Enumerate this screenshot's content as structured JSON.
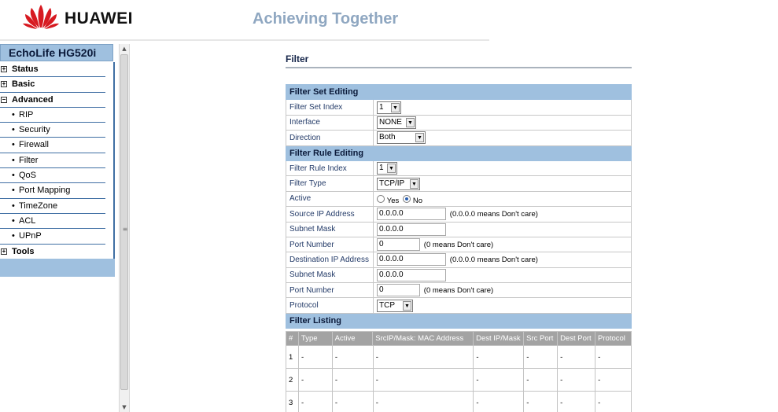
{
  "header": {
    "brand": "HUAWEI",
    "slogan": "Achieving Together",
    "logo_icon": "huawei-petal-logo"
  },
  "sidebar": {
    "model": "EchoLife HG520i",
    "items": [
      {
        "label": "Status",
        "kind": "top",
        "toggle": "+"
      },
      {
        "label": "Basic",
        "kind": "top",
        "toggle": "+"
      },
      {
        "label": "Advanced",
        "kind": "top",
        "toggle": "−"
      },
      {
        "label": "RIP",
        "kind": "sub",
        "bullet": "•"
      },
      {
        "label": "Security",
        "kind": "sub",
        "bullet": "•"
      },
      {
        "label": "Firewall",
        "kind": "sub",
        "bullet": "•"
      },
      {
        "label": "Filter",
        "kind": "sub",
        "bullet": "•"
      },
      {
        "label": "QoS",
        "kind": "sub",
        "bullet": "•"
      },
      {
        "label": "Port Mapping",
        "kind": "sub",
        "bullet": "•"
      },
      {
        "label": "TimeZone",
        "kind": "sub",
        "bullet": "•"
      },
      {
        "label": "ACL",
        "kind": "sub",
        "bullet": "•"
      },
      {
        "label": "UPnP",
        "kind": "sub",
        "bullet": "•"
      },
      {
        "label": "Tools",
        "kind": "top",
        "toggle": "+"
      }
    ]
  },
  "page": {
    "title": "Filter"
  },
  "filter_set": {
    "section": "Filter Set Editing",
    "index_label": "Filter Set Index",
    "index_value": "1",
    "interface_label": "Interface",
    "interface_value": "NONE",
    "direction_label": "Direction",
    "direction_value": "Both"
  },
  "filter_rule": {
    "section": "Filter Rule Editing",
    "index_label": "Filter Rule Index",
    "index_value": "1",
    "type_label": "Filter Type",
    "type_value": "TCP/IP",
    "active_label": "Active",
    "active_yes": "Yes",
    "active_no": "No",
    "active_selected": "No",
    "src_ip_label": "Source IP Address",
    "src_ip_value": "0.0.0.0",
    "src_ip_note": "(0.0.0.0 means Don't care)",
    "src_mask_label": "Subnet Mask",
    "src_mask_value": "0.0.0.0",
    "src_port_label": "Port Number",
    "src_port_value": "0",
    "src_port_note": "(0 means Don't care)",
    "dst_ip_label": "Destination IP Address",
    "dst_ip_value": "0.0.0.0",
    "dst_ip_note": "(0.0.0.0 means Don't care)",
    "dst_mask_label": "Subnet Mask",
    "dst_mask_value": "0.0.0.0",
    "dst_port_label": "Port Number",
    "dst_port_value": "0",
    "dst_port_note": "(0 means Don't care)",
    "protocol_label": "Protocol",
    "protocol_value": "TCP"
  },
  "listing": {
    "section": "Filter Listing",
    "columns": [
      "#",
      "Type",
      "Active",
      "SrcIP/Mask: MAC Address",
      "Dest IP/Mask",
      "Src Port",
      "Dest Port",
      "Protocol"
    ],
    "rows": [
      [
        "1",
        "-",
        "-",
        "-",
        "-",
        "-",
        "-",
        "-"
      ],
      [
        "2",
        "-",
        "-",
        "-",
        "-",
        "-",
        "-",
        "-"
      ],
      [
        "3",
        "-",
        "-",
        "-",
        "-",
        "-",
        "-",
        "-"
      ]
    ]
  },
  "colors": {
    "section_bg": "#9fc0df",
    "nav_border": "#3f6ea3",
    "slogan": "#8fa7c1",
    "list_header_bg": "#a3a3a3"
  }
}
